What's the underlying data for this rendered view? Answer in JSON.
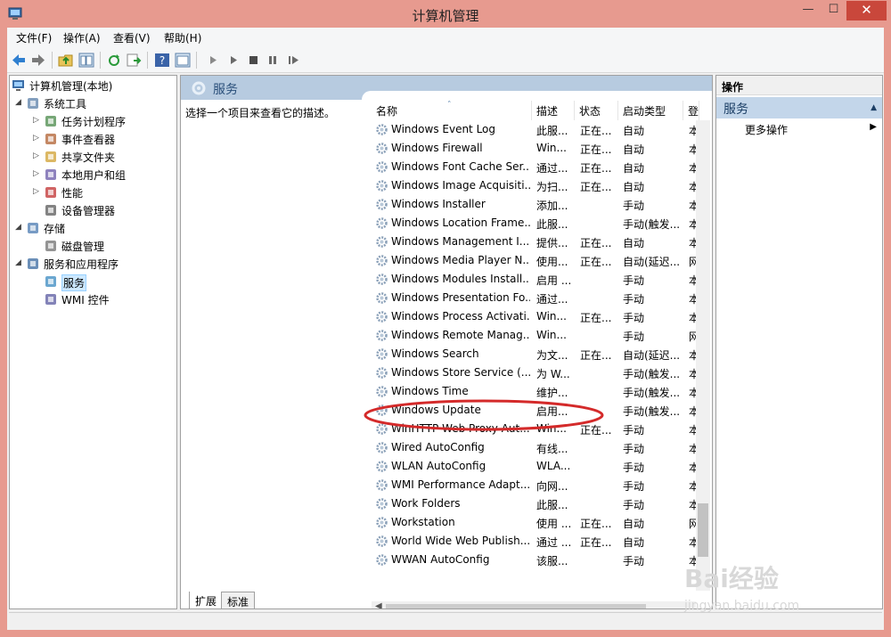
{
  "window": {
    "title": "计算机管理",
    "minimize": "—",
    "maximize": "☐",
    "close": "✕"
  },
  "menu": [
    "文件(F)",
    "操作(A)",
    "查看(V)",
    "帮助(H)"
  ],
  "tree": {
    "root": "计算机管理(本地)",
    "items": [
      {
        "label": "系统工具",
        "level": 1,
        "expander": "◢",
        "icon": "tools-icon"
      },
      {
        "label": "任务计划程序",
        "level": 2,
        "expander": "▷",
        "icon": "clock-icon"
      },
      {
        "label": "事件查看器",
        "level": 2,
        "expander": "▷",
        "icon": "event-viewer-icon"
      },
      {
        "label": "共享文件夹",
        "level": 2,
        "expander": "▷",
        "icon": "shared-folder-icon"
      },
      {
        "label": "本地用户和组",
        "level": 2,
        "expander": "▷",
        "icon": "users-icon"
      },
      {
        "label": "性能",
        "level": 2,
        "expander": "▷",
        "icon": "performance-icon"
      },
      {
        "label": "设备管理器",
        "level": 2,
        "expander": "",
        "icon": "device-manager-icon"
      },
      {
        "label": "存储",
        "level": 1,
        "expander": "◢",
        "icon": "storage-icon"
      },
      {
        "label": "磁盘管理",
        "level": 2,
        "expander": "",
        "icon": "disk-icon"
      },
      {
        "label": "服务和应用程序",
        "level": 1,
        "expander": "◢",
        "icon": "services-apps-icon"
      },
      {
        "label": "服务",
        "level": 2,
        "expander": "",
        "icon": "services-icon",
        "selected": true
      },
      {
        "label": "WMI 控件",
        "level": 2,
        "expander": "",
        "icon": "wmi-icon"
      }
    ]
  },
  "center": {
    "header_title": "服务",
    "description_prompt": "选择一个项目来查看它的描述。",
    "columns": [
      "名称",
      "描述",
      "状态",
      "启动类型",
      "登"
    ],
    "sort_arrow": "˄",
    "rows": [
      [
        "Windows Event Log",
        "此服...",
        "正在...",
        "自动",
        "本"
      ],
      [
        "Windows Firewall",
        "Win...",
        "正在...",
        "自动",
        "本"
      ],
      [
        "Windows Font Cache Ser...",
        "通过...",
        "正在...",
        "自动",
        "本"
      ],
      [
        "Windows Image Acquisiti...",
        "为扫...",
        "正在...",
        "自动",
        "本"
      ],
      [
        "Windows Installer",
        "添加...",
        "",
        "手动",
        "本"
      ],
      [
        "Windows Location Frame...",
        "此服...",
        "",
        "手动(触发...",
        "本"
      ],
      [
        "Windows Management I...",
        "提供...",
        "正在...",
        "自动",
        "本"
      ],
      [
        "Windows Media Player N...",
        "使用...",
        "正在...",
        "自动(延迟...",
        "网"
      ],
      [
        "Windows Modules Install...",
        "启用 ...",
        "",
        "手动",
        "本"
      ],
      [
        "Windows Presentation Fo...",
        "通过...",
        "",
        "手动",
        "本"
      ],
      [
        "Windows Process Activati...",
        "Win...",
        "正在...",
        "手动",
        "本"
      ],
      [
        "Windows Remote Manag...",
        "Win...",
        "",
        "手动",
        "网"
      ],
      [
        "Windows Search",
        "为文...",
        "正在...",
        "自动(延迟...",
        "本"
      ],
      [
        "Windows Store Service (...",
        "为 W...",
        "",
        "手动(触发...",
        "本"
      ],
      [
        "Windows Time",
        "维护...",
        "",
        "手动(触发...",
        "本"
      ],
      [
        "Windows Update",
        "启用...",
        "",
        "手动(触发...",
        "本"
      ],
      [
        "WinHTTP Web Proxy Aut...",
        "Win...",
        "正在...",
        "手动",
        "本"
      ],
      [
        "Wired AutoConfig",
        "有线...",
        "",
        "手动",
        "本"
      ],
      [
        "WLAN AutoConfig",
        "WLA...",
        "",
        "手动",
        "本"
      ],
      [
        "WMI Performance Adapt...",
        "向网...",
        "",
        "手动",
        "本"
      ],
      [
        "Work Folders",
        "此服...",
        "",
        "手动",
        "本"
      ],
      [
        "Workstation",
        "使用 ...",
        "正在...",
        "自动",
        "网"
      ],
      [
        "World Wide Web Publish...",
        "通过 ...",
        "正在...",
        "自动",
        "本"
      ],
      [
        "WWAN AutoConfig",
        "该服...",
        "",
        "手动",
        "本"
      ]
    ],
    "tabs": [
      "扩展",
      "标准"
    ]
  },
  "actions": {
    "header": "操作",
    "section": "服务",
    "section_collapse": "▲",
    "more": "更多操作",
    "more_arrow": "▶"
  },
  "watermark": {
    "brand": "Bai经验",
    "url": "jingyan.baidu.com"
  },
  "colors": {
    "window_border": "#e79a8f",
    "header_band": "#b7cbe0",
    "action_section": "#c3d6ea",
    "annotation": "#d42a2a"
  }
}
